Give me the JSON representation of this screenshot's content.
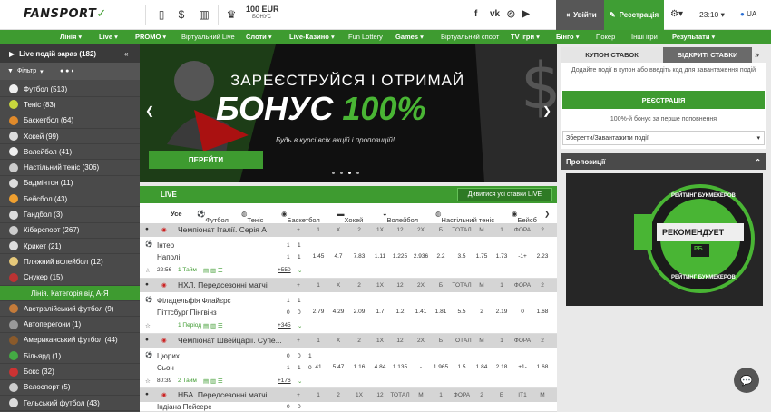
{
  "header": {
    "logo": "FANSPORT",
    "bonus_amount": "100 EUR",
    "bonus_label": "БОНУС",
    "login": "Увійти",
    "register": "Реєстрація",
    "time": "23:10",
    "lang": "UA",
    "social": [
      "f",
      "vk",
      "ig",
      "yt"
    ]
  },
  "nav": [
    "Лінія",
    "Live",
    "PROMO",
    "Віртуальний Live",
    "Слоти",
    "Live-Казино",
    "Fun Lottery",
    "Games",
    "Віртуальний спорт",
    "TV ігри",
    "Бінго",
    "Покер",
    "Інші ігри",
    "Результати"
  ],
  "sidebar": {
    "live_title": "Live подій зараз (182)",
    "filter": "Фільтр",
    "items": [
      "Футбол (513)",
      "Теніс (83)",
      "Баскетбол (64)",
      "Хокей (99)",
      "Волейбол (41)",
      "Настільний теніс (306)",
      "Бадмінтон (11)",
      "Бейсбол (43)",
      "Гандбол (3)",
      "Кіберспорт (267)",
      "Крикет (21)",
      "Пляжний волейбол (12)",
      "Снукер (15)",
      "Лінія. Категорія від А-Я",
      "Австралійський футбол (9)",
      "Автоперегони (1)",
      "Американський футбол (44)",
      "Більярд (1)",
      "Бокс (32)",
      "Велоспорт (5)",
      "Гельський футбол (43)"
    ]
  },
  "banner": {
    "line1": "ЗАРЕЄСТРУЙСЯ І ОТРИМАЙ",
    "line2a": "БОНУС ",
    "line2b": "100%",
    "sub": "Будь в курсі всіх акцій і пропозицій!",
    "button": "ПЕРЕЙТИ"
  },
  "live": {
    "title": "LIVE",
    "all_button": "Дивитися усі ставки LIVE",
    "tabs": [
      "Усе",
      "Футбол",
      "Теніс",
      "Баскетбол",
      "Хокей",
      "Волейбол",
      "Настільний теніс",
      "Бейсб"
    ]
  },
  "leagues": [
    {
      "name": "Чемпіонат Італії. Серія А",
      "cols": [
        "+",
        "1",
        "X",
        "2",
        "1X",
        "12",
        "2X",
        "Б",
        "ТОТАЛ",
        "М",
        "1",
        "ФОРА",
        "2"
      ],
      "team1": "Інтер",
      "team2": "Наполі",
      "s1": "1",
      "s2": "1",
      "s1b": "1",
      "s2b": "1",
      "time": "22:56",
      "period": "1 Тайм",
      "more": "+550",
      "odds": [
        "1.45",
        "4.7",
        "7.83",
        "1.11",
        "1.225",
        "2.936",
        "2.2",
        "3.5",
        "1.75",
        "1.73",
        "-1+",
        "2.23"
      ]
    },
    {
      "name": "НХЛ. Передсезонні матчі",
      "cols": [
        "+",
        "1",
        "X",
        "2",
        "1X",
        "12",
        "2X",
        "Б",
        "ТОТАЛ",
        "М",
        "1",
        "ФОРА",
        "2"
      ],
      "team1": "Філадельфія Флайєрс",
      "team2": "Піттсбург Пінгвінз",
      "s1": "1",
      "s2": "0",
      "s1b": "1",
      "s2b": "0",
      "time": "",
      "period": "1 Період",
      "more": "+345",
      "odds": [
        "2.79",
        "4.29",
        "2.09",
        "1.7",
        "1.2",
        "1.41",
        "1.81",
        "5.5",
        "2",
        "2.19",
        "0",
        "1.68"
      ]
    },
    {
      "name": "Чемпіонат Швейцарії. Супе...",
      "cols": [
        "+",
        "1",
        "X",
        "2",
        "1X",
        "12",
        "2X",
        "Б",
        "ТОТАЛ",
        "М",
        "1",
        "ФОРА",
        "2"
      ],
      "team1": "Цюрих",
      "team2": "Сьон",
      "s1": "0",
      "s2": "1",
      "s1b": "0",
      "s2b": "1",
      "s3a": "1",
      "s3b": "0",
      "time": "80:39",
      "period": "2 Тайм",
      "more": "+176",
      "odds": [
        "41",
        "5.47",
        "1.16",
        "4.84",
        "1.135",
        "-",
        "1.965",
        "1.5",
        "1.84",
        "2.18",
        "+1-",
        "1.68"
      ]
    },
    {
      "name": "НБА. Передсезонні матчі",
      "cols": [
        "+",
        "1",
        "2",
        "1X",
        "12",
        "ТОТАЛ",
        "М",
        "1",
        "ФОРА",
        "2",
        "Б",
        "ІТ1",
        "М"
      ],
      "team1": "Індіана Пейсерс",
      "s1": "0",
      "s1b": "0"
    }
  ],
  "coupon": {
    "tab1": "КУПОН СТАВОК",
    "tab2": "ВІДКРИТІ СТАВКИ",
    "msg": "Додайте події в купон або введіть код для завантаження подій",
    "register": "РЕЄСТРАЦІЯ",
    "bonus": "100%-й бонус за перше поповнення",
    "save_load": "Зберегти/Завантажити події"
  },
  "offers": {
    "title": "Пропозиції",
    "promo_top": "РЕЙТИНГ БУКМЕКЕРОВ",
    "promo_mid": "РЕКОМЕНДУЕТ",
    "promo_logo": "РБ",
    "promo_bottom": "РЕЙТИНГ БУКМЕКЕРОВ"
  }
}
